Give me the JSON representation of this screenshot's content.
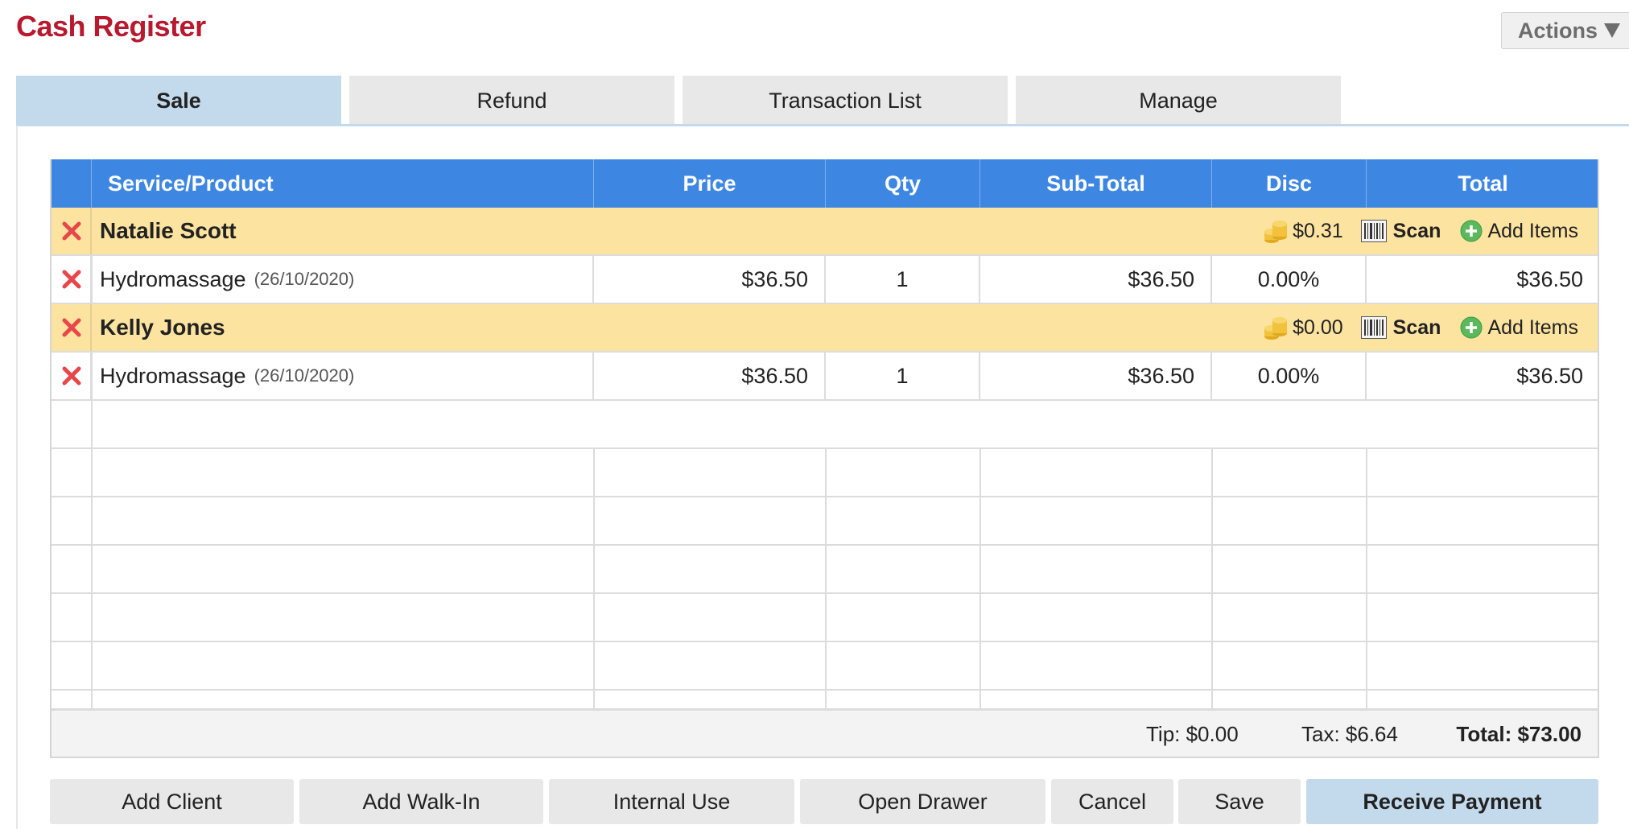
{
  "header": {
    "title": "Cash Register",
    "actions_label": "Actions"
  },
  "tabs": [
    {
      "label": "Sale",
      "active": true
    },
    {
      "label": "Refund",
      "active": false
    },
    {
      "label": "Transaction List",
      "active": false
    },
    {
      "label": "Manage",
      "active": false
    }
  ],
  "table": {
    "columns": [
      "Service/Product",
      "Price",
      "Qty",
      "Sub-Total",
      "Disc",
      "Total"
    ],
    "clients": [
      {
        "name": "Natalie Scott",
        "discount": "$0.31",
        "scan_label": "Scan",
        "add_items_label": "Add Items",
        "items": [
          {
            "service": "Hydromassage",
            "date": "(26/10/2020)",
            "price": "$36.50",
            "qty": "1",
            "subtotal": "$36.50",
            "disc": "0.00%",
            "total": "$36.50"
          }
        ]
      },
      {
        "name": "Kelly Jones",
        "discount": "$0.00",
        "scan_label": "Scan",
        "add_items_label": "Add Items",
        "items": [
          {
            "service": "Hydromassage",
            "date": "(26/10/2020)",
            "price": "$36.50",
            "qty": "1",
            "subtotal": "$36.50",
            "disc": "0.00%",
            "total": "$36.50"
          }
        ]
      }
    ]
  },
  "totals": {
    "tip": "Tip: $0.00",
    "tax": "Tax: $6.64",
    "total": "Total: $73.00"
  },
  "buttons": {
    "add_client": "Add Client",
    "add_walk_in": "Add Walk-In",
    "internal_use": "Internal Use",
    "open_drawer": "Open Drawer",
    "cancel": "Cancel",
    "save": "Save",
    "receive_payment": "Receive Payment"
  },
  "colors": {
    "title": "#b8192e",
    "header_bg": "#3d87e2",
    "client_row_bg": "#fde3a0",
    "active_tab_bg": "#c3daec",
    "remove_icon": "#e8474a"
  }
}
